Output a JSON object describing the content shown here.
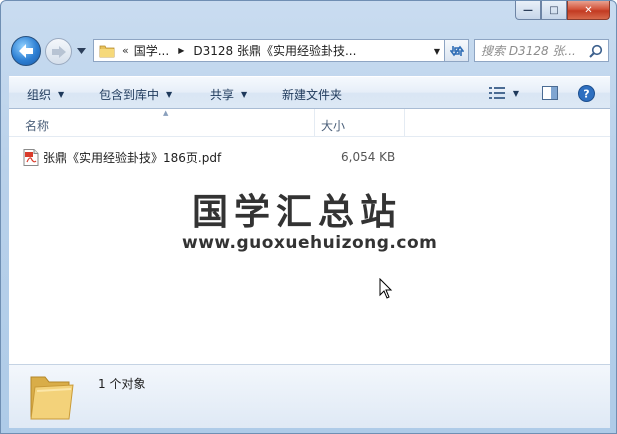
{
  "window": {
    "minimize_glyph": "—",
    "maximize_glyph": "□",
    "close_glyph": "✕"
  },
  "address": {
    "overflow": "«",
    "crumbs": [
      "国学...",
      "D3128 张鼎《实用经验卦技..."
    ]
  },
  "search": {
    "placeholder": "搜索 D3128 张..."
  },
  "toolbar": {
    "organize": "组织",
    "include_in_library": "包含到库中",
    "share": "共享",
    "new_folder": "新建文件夹"
  },
  "columns": {
    "name": "名称",
    "size": "大小"
  },
  "files": [
    {
      "name": "张鼎《实用经验卦技》186页.pdf",
      "size": "6,054 KB"
    }
  ],
  "watermark": {
    "title": "国学汇总站",
    "url": "www.guoxuehuizong.com"
  },
  "status": {
    "item_count": "1 个对象"
  },
  "icons": {
    "back": "back-arrow-icon",
    "forward": "forward-arrow-icon",
    "refresh": "refresh-icon",
    "search": "search-icon",
    "views": "view-options-icon",
    "preview": "preview-pane-icon",
    "help": "help-icon",
    "pdf": "pdf-file-icon",
    "folder": "folder-icon"
  },
  "colors": {
    "frame": "#b9d1ea",
    "toolbar_text": "#1e395b",
    "close_button": "#c23a22"
  }
}
